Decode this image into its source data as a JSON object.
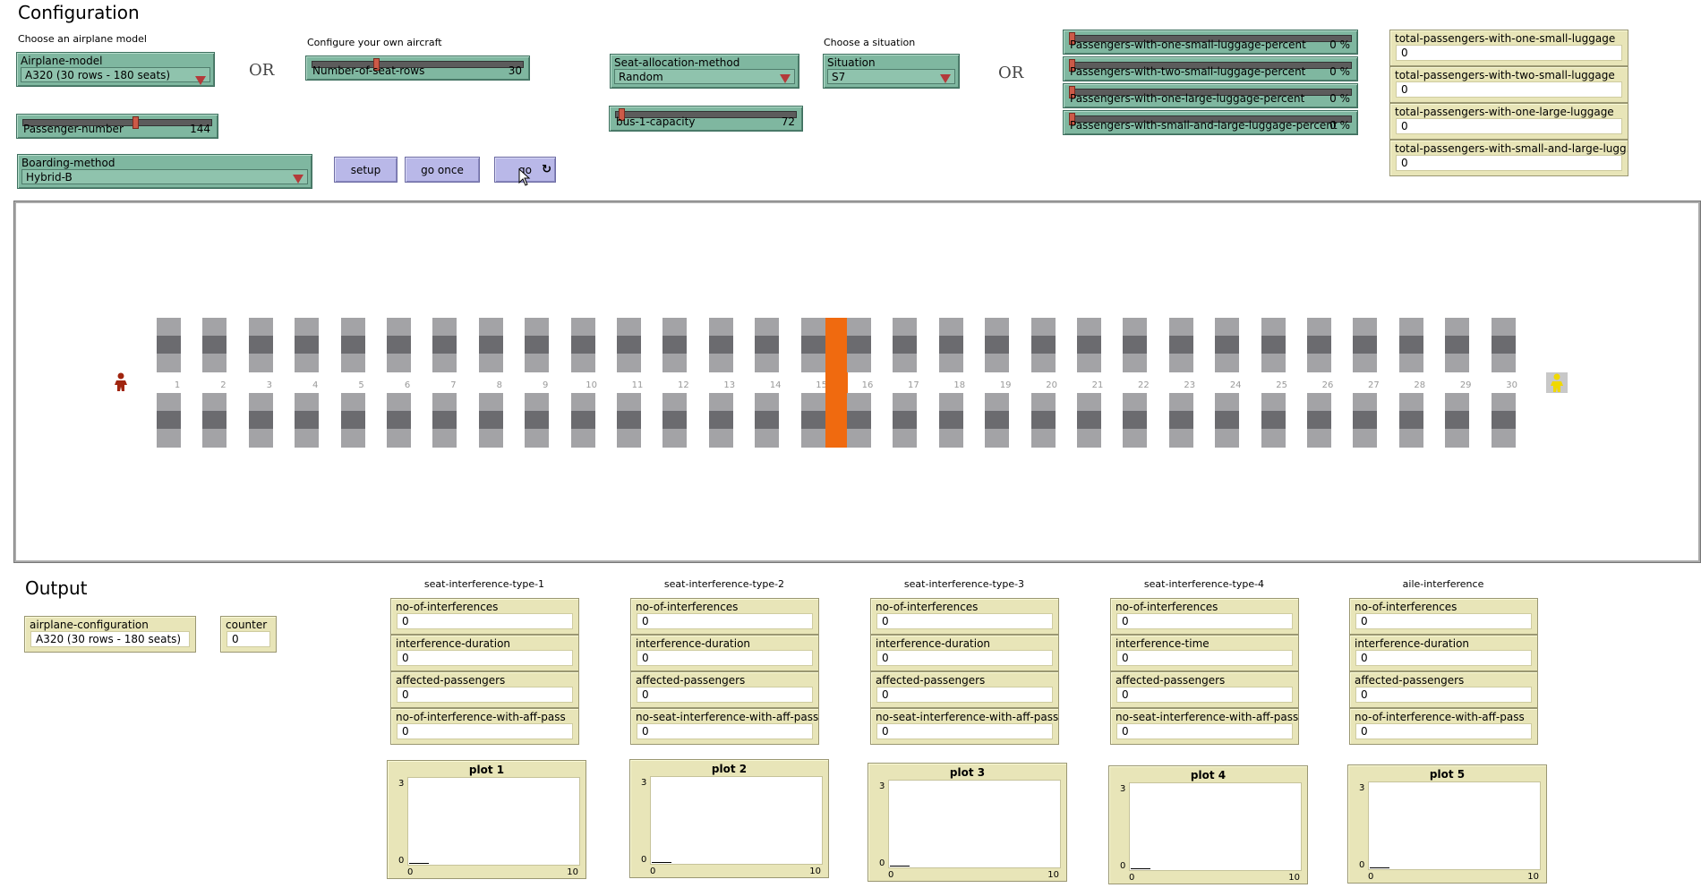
{
  "config": {
    "title": "Configuration",
    "choose_model_label": "Choose an airplane model",
    "configure_own_label": "Configure your own aircraft",
    "or1": "OR",
    "or2": "OR",
    "choose_situation_label": "Choose a situation",
    "airplane_model": {
      "name": "Airplane-model",
      "value": "A320 (30 rows - 180 seats)"
    },
    "seat_rows_slider": {
      "name": "Number-of-seat-rows",
      "value": "30",
      "fraction": 0.3
    },
    "passenger_slider": {
      "name": "Passenger-number",
      "value": "144",
      "fraction": 0.6
    },
    "seat_allocation": {
      "name": "Seat-allocation-method",
      "value": "Random"
    },
    "situation": {
      "name": "Situation",
      "value": "S7"
    },
    "bus_slider": {
      "name": "bus-1-capacity",
      "value": "72",
      "fraction": 0.02
    },
    "boarding_method": {
      "name": "Boarding-method",
      "value": "Hybrid-B"
    },
    "buttons": {
      "setup": "setup",
      "go_once": "go once",
      "go": "go"
    },
    "luggage_sliders": [
      {
        "name": "Passengers-with-one-small-luggage-percent",
        "value": "0 %"
      },
      {
        "name": "Passengers-with-two-small-luggage-percent",
        "value": "0 %"
      },
      {
        "name": "Passengers-with-one-large-luggage-percent",
        "value": "0 %"
      },
      {
        "name": "Passengers-with-small-and-large-luggage-percent",
        "value": "0 %"
      }
    ],
    "totals": [
      {
        "name": "total-passengers-with-one-small-luggage",
        "value": "0"
      },
      {
        "name": "total-passengers-with-two-small-luggage",
        "value": "0"
      },
      {
        "name": "total-passengers-with-one-large-luggage",
        "value": "0"
      },
      {
        "name": "total-passengers-with-small-and-large-lugg...",
        "value": "0"
      }
    ]
  },
  "world": {
    "rows": [
      "1",
      "2",
      "3",
      "4",
      "5",
      "6",
      "7",
      "8",
      "9",
      "10",
      "11",
      "12",
      "13",
      "14",
      "15",
      "16",
      "17",
      "18",
      "19",
      "20",
      "21",
      "22",
      "23",
      "24",
      "25",
      "26",
      "27",
      "28",
      "29",
      "30"
    ],
    "highlight_color": "#f06a0f",
    "highlighted_after_row": "15"
  },
  "output": {
    "title": "Output",
    "airplane_configuration": {
      "name": "airplane-configuration",
      "value": "A320 (30 rows - 180 seats)"
    },
    "counter": {
      "name": "counter",
      "value": "0"
    },
    "groups": [
      {
        "title": "seat-interference-type-1",
        "monitors": [
          {
            "name": "no-of-interferences",
            "value": "0"
          },
          {
            "name": "interference-duration",
            "value": "0"
          },
          {
            "name": "affected-passengers",
            "value": "0"
          },
          {
            "name": "no-of-interference-with-aff-pass",
            "value": "0"
          }
        ],
        "plot": {
          "title": "plot 1",
          "ymax": "3",
          "ymin": "0",
          "xmin": "0",
          "xmax": "10"
        }
      },
      {
        "title": "seat-interference-type-2",
        "monitors": [
          {
            "name": "no-of-interferences",
            "value": "0"
          },
          {
            "name": "interference-duration",
            "value": "0"
          },
          {
            "name": "affected-passengers",
            "value": "0"
          },
          {
            "name": "no-seat-interference-with-aff-pass",
            "value": "0"
          }
        ],
        "plot": {
          "title": "plot 2",
          "ymax": "3",
          "ymin": "0",
          "xmin": "0",
          "xmax": "10"
        }
      },
      {
        "title": "seat-interference-type-3",
        "monitors": [
          {
            "name": "no-of-interferences",
            "value": "0"
          },
          {
            "name": "interference-duration",
            "value": "0"
          },
          {
            "name": "affected-passengers",
            "value": "0"
          },
          {
            "name": "no-seat-interference-with-aff-pass",
            "value": "0"
          }
        ],
        "plot": {
          "title": "plot 3",
          "ymax": "3",
          "ymin": "0",
          "xmin": "0",
          "xmax": "10"
        }
      },
      {
        "title": "seat-interference-type-4",
        "monitors": [
          {
            "name": "no-of-interferences",
            "value": "0"
          },
          {
            "name": "interference-time",
            "value": "0"
          },
          {
            "name": "affected-passengers",
            "value": "0"
          },
          {
            "name": "no-seat-interference-with-aff-pass",
            "value": "0"
          }
        ],
        "plot": {
          "title": "plot 4",
          "ymax": "3",
          "ymin": "0",
          "xmin": "0",
          "xmax": "10"
        }
      },
      {
        "title": "aile-interference",
        "monitors": [
          {
            "name": "no-of-interferences",
            "value": "0"
          },
          {
            "name": "interference-duration",
            "value": "0"
          },
          {
            "name": "affected-passengers",
            "value": "0"
          },
          {
            "name": "no-of-interference-with-aff-pass",
            "value": "0"
          }
        ],
        "plot": {
          "title": "plot 5",
          "ymax": "3",
          "ymin": "0",
          "xmin": "0",
          "xmax": "10"
        }
      }
    ]
  },
  "icons": {
    "person_left": "person-icon",
    "person_right": "person-icon",
    "forever": "forever-icon",
    "chooser_arrow": "chevron-down-icon"
  }
}
